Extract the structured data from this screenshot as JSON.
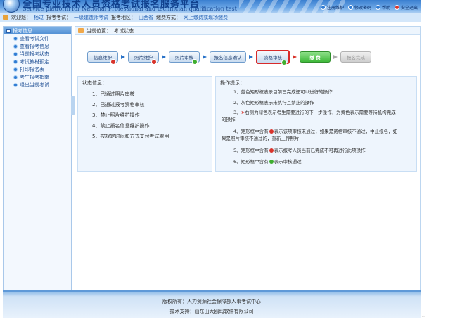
{
  "header": {
    "title_cn": "全国专业技术人员资格考试报名服务平台",
    "title_en": "Service platform for National Professional and technician qualification test",
    "tools": [
      {
        "label": "注册维护",
        "icon": "user-icon"
      },
      {
        "label": "修改密码",
        "icon": "key-icon"
      },
      {
        "label": "帮助",
        "icon": "help-icon"
      },
      {
        "label": "安全退出",
        "icon": "logout-icon"
      }
    ]
  },
  "infobar": {
    "welcome_label": "欢迎您：",
    "user": "杨过",
    "exam_label": "报考考试：",
    "exam": "一级建造师考试",
    "region_label": "报考地区：",
    "region": "山西省",
    "payment_label": "缴费方式：",
    "payment": "网上缴费或现场缴费"
  },
  "sidebar": {
    "title": "报考信息",
    "items": [
      "查看考试文件",
      "查看报考信息",
      "当前报考状态",
      "考试教材预定",
      "打印报名表",
      "考生报考指南",
      "退出当前考试"
    ]
  },
  "breadcrumb": {
    "label": "当前位置：",
    "page": "考试状态"
  },
  "flow": {
    "steps": [
      {
        "label": "信息维护",
        "state": "fail"
      },
      {
        "label": "照片维护",
        "state": "fail"
      },
      {
        "label": "照片审核",
        "state": "pass"
      },
      {
        "label": "报名信息确认",
        "state": "none"
      },
      {
        "label": "资格审核",
        "state": "pass_current"
      },
      {
        "label": "缴 费",
        "state": "next"
      },
      {
        "label": "报名完成",
        "state": "disabled"
      }
    ]
  },
  "status": {
    "title": "状态信息：",
    "items": [
      "1、已通过照片审核",
      "2、已通过报考资格审核",
      "3、禁止照片维护操作",
      "4、禁止报名信息维护操作",
      "5、按规定时间和方式支付考试费用"
    ]
  },
  "tips": {
    "title": "操作提示：",
    "t1": "1、蓝色矩形框表示目前已完成还可以进行的操作",
    "t2": "2、灰色矩形框表示未执行且禁止的操作",
    "t3a": "3、",
    "t3b": "右侧为绿色表示考生需要进行的下一步操作，为黄色表示需要等待机构完成",
    "t3c": "的操作",
    "t4a": "4、矩形框中含有",
    "t4b": "表示该项审核未通过，如果是资格审核不通过，中止报名，如",
    "t4c": "果是照片审核不通过的，重新上传照片",
    "t5a": "5、矩形框中含有",
    "t5b": "表示报考人员当前已完成不可再进行此项操作",
    "t6a": "6、矩形框中含有",
    "t6b": "表示审核通过"
  },
  "footer": {
    "copyright": "版权所有：人力资源社会保障部人事考试中心",
    "support": "技术支持：山东山大鸥玛软件有限公司"
  },
  "colors": {
    "primary": "#2f7bd3",
    "fail": "#d8342c",
    "pass": "#3fae2f",
    "highlight_border": "#d82b2b"
  }
}
